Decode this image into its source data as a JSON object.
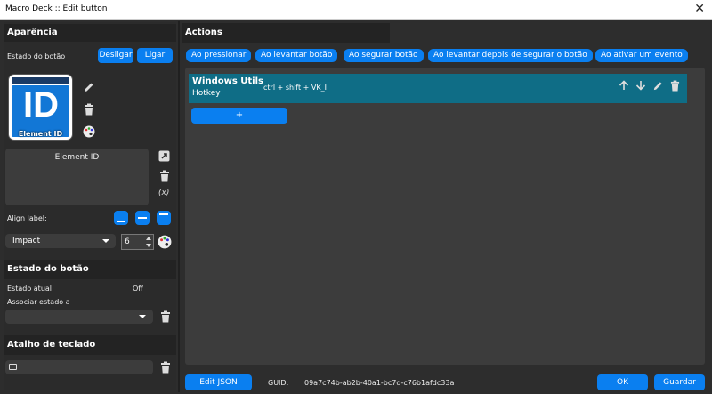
{
  "window": {
    "title": "Macro Deck :: Edit button",
    "close_glyph": "✕"
  },
  "appearance": {
    "header": "Aparência",
    "state_label": "Estado do botão",
    "btn_off": "Desligar",
    "btn_on": "Ligar",
    "icon_text": "ID",
    "icon_caption": "Element ID",
    "label_text": "Element ID",
    "variable_glyph": "(x)",
    "align_label": "Align label:",
    "font": "Impact",
    "font_size": "6"
  },
  "button_state": {
    "header": "Estado do botão",
    "current_label": "Estado atual",
    "current_value": "Off",
    "bind_label": "Associar estado a",
    "bind_value": ""
  },
  "hotkey": {
    "header": "Atalho de teclado",
    "value": ""
  },
  "actions": {
    "header": "Actions",
    "tabs": [
      "Ao pressionar",
      "Ao levantar botão",
      "Ao segurar botão",
      "Ao levantar depois de segurar o botão",
      "Ao ativar um evento"
    ],
    "items": [
      {
        "plugin": "Windows Utils",
        "action": "Hotkey",
        "config": "ctrl + shift + VK_I"
      }
    ],
    "add_label": "+"
  },
  "footer": {
    "edit_json": "Edit JSON",
    "guid_label": "GUID:",
    "guid_value": "09a7c74b-ab2b-40a1-bc7d-c76b1afdc33a",
    "ok": "OK",
    "save": "Guardar"
  },
  "colors": {
    "accent": "#0a7ff0",
    "action_row": "#0f6d86",
    "panel": "#2b2b2b",
    "header": "#232323"
  },
  "icons": [
    "close-icon",
    "pencil-icon",
    "trash-icon",
    "palette-icon",
    "expand-icon",
    "align-bottom-icon",
    "align-center-icon",
    "align-top-icon",
    "arrow-up-icon",
    "arrow-down-icon",
    "keyboard-icon",
    "chevron-down-icon"
  ]
}
